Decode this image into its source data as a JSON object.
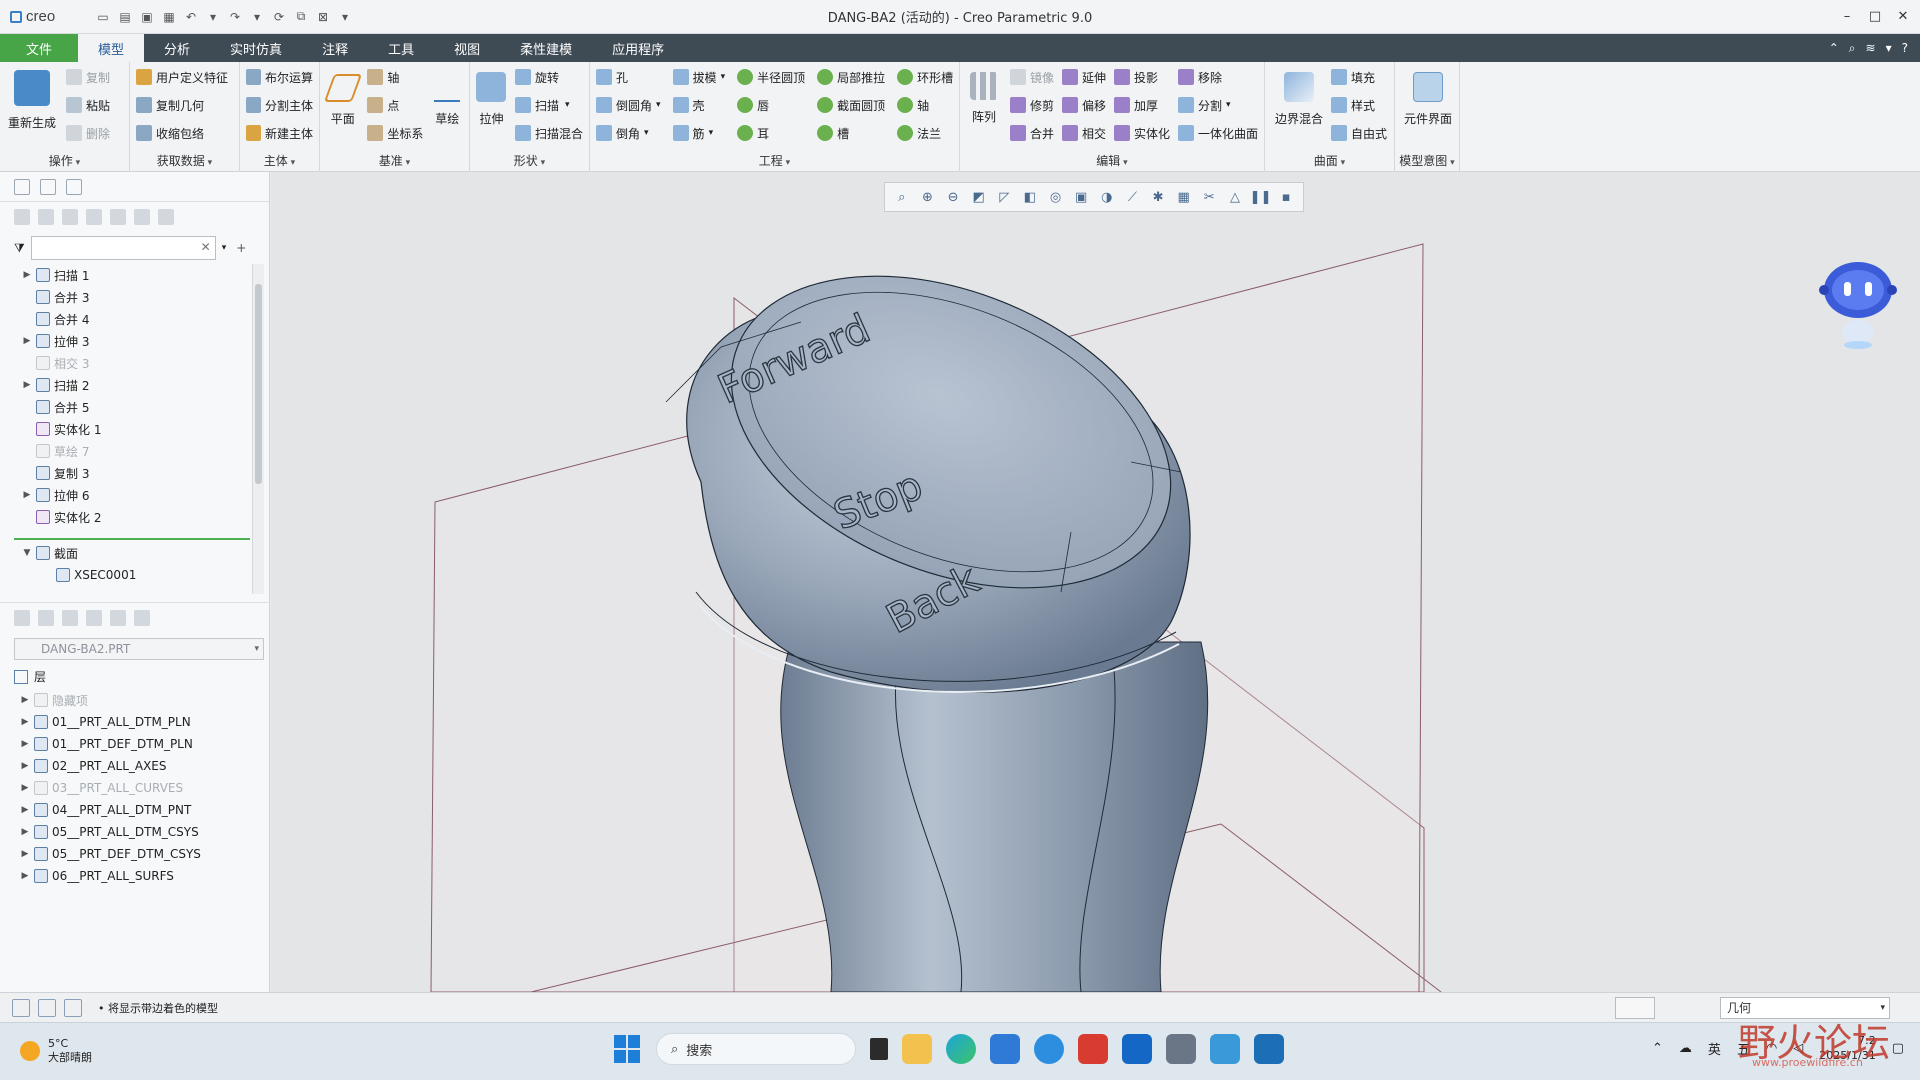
{
  "app": {
    "logo": "creo",
    "window_title": "DANG-BA2 (活动的) - Creo Parametric 9.0"
  },
  "tabs": [
    {
      "label": "文件"
    },
    {
      "label": "模型"
    },
    {
      "label": "分析"
    },
    {
      "label": "实时仿真"
    },
    {
      "label": "注释"
    },
    {
      "label": "工具"
    },
    {
      "label": "视图"
    },
    {
      "label": "柔性建模"
    },
    {
      "label": "应用程序"
    }
  ],
  "ribbon": {
    "operations": {
      "label": "操作",
      "regen": "重新生成",
      "copy": "复制",
      "paste": "粘贴",
      "delete": "删除"
    },
    "get_data": {
      "label": "获取数据",
      "udf": "用户定义特征",
      "copy_geom": "复制几何",
      "shrinkwrap": "收缩包络"
    },
    "body": {
      "label": "主体",
      "boolean": "布尔运算",
      "split_body": "分割主体",
      "new_body": "新建主体"
    },
    "datum": {
      "label": "基准",
      "plane": "平面",
      "axis": "轴",
      "point": "点",
      "csys": "坐标系",
      "sketch": "草绘"
    },
    "shapes": {
      "label": "形状",
      "extrude": "拉伸",
      "revolve": "旋转",
      "sweep": "扫描",
      "swept_blend": "扫描混合"
    },
    "engineering": {
      "label": "工程",
      "hole": "孔",
      "round": "倒圆角",
      "chamfer": "倒角",
      "draft": "拔模",
      "shell": "壳",
      "rib": "筋",
      "radius_dome": "半径圆顶",
      "lip": "唇",
      "ear": "耳",
      "local_push": "局部推拉",
      "section_dome": "截面圆顶",
      "slot": "槽",
      "toroidal_bend": "环形槽",
      "shaft": "轴",
      "flange": "法兰"
    },
    "editing": {
      "label": "编辑",
      "pattern": "阵列",
      "mirror": "镜像",
      "trim": "修剪",
      "merge": "合并",
      "extend": "延伸",
      "offset": "偏移",
      "intersect": "相交",
      "project": "投影",
      "thicken": "加厚",
      "solidify": "实体化",
      "remove": "移除",
      "split": "分割",
      "unify": "一体化曲面"
    },
    "surfaces": {
      "label": "曲面",
      "boundary_blend": "边界混合",
      "fill": "填充",
      "style": "样式",
      "freestyle": "自由式"
    },
    "model_intent": {
      "label": "模型意图",
      "component_interface": "元件界面"
    }
  },
  "model_tree": {
    "items": [
      {
        "label": "扫描 1",
        "expandable": true,
        "suppressed": false
      },
      {
        "label": "合并 3",
        "expandable": false,
        "suppressed": false
      },
      {
        "label": "合并 4",
        "expandable": false,
        "suppressed": false
      },
      {
        "label": "拉伸 3",
        "expandable": true,
        "suppressed": false
      },
      {
        "label": "相交 3",
        "expandable": false,
        "suppressed": true
      },
      {
        "label": "扫描 2",
        "expandable": true,
        "suppressed": false
      },
      {
        "label": "合并 5",
        "expandable": false,
        "suppressed": false
      },
      {
        "label": "实体化 1",
        "expandable": false,
        "suppressed": false
      },
      {
        "label": "草绘 7",
        "expandable": false,
        "suppressed": true
      },
      {
        "label": "复制 3",
        "expandable": false,
        "suppressed": false
      },
      {
        "label": "拉伸 6",
        "expandable": true,
        "suppressed": false
      },
      {
        "label": "实体化 2",
        "expandable": false,
        "suppressed": false
      }
    ],
    "sections_label": "截面",
    "xsec": "XSEC0001"
  },
  "layer_tree": {
    "part": "DANG-BA2.PRT",
    "root": "层",
    "items": [
      {
        "label": "隐藏项",
        "dim": true
      },
      {
        "label": "01__PRT_ALL_DTM_PLN",
        "dim": false
      },
      {
        "label": "01__PRT_DEF_DTM_PLN",
        "dim": false
      },
      {
        "label": "02__PRT_ALL_AXES",
        "dim": false
      },
      {
        "label": "03__PRT_ALL_CURVES",
        "dim": true
      },
      {
        "label": "04__PRT_ALL_DTM_PNT",
        "dim": false
      },
      {
        "label": "05__PRT_ALL_DTM_CSYS",
        "dim": false
      },
      {
        "label": "05__PRT_DEF_DTM_CSYS",
        "dim": false
      },
      {
        "label": "06__PRT_ALL_SURFS",
        "dim": false
      }
    ]
  },
  "model_text": {
    "top": "Forward",
    "middle": "Stop",
    "bottom": "Back"
  },
  "status": {
    "message": "• 将显示带边着色的模型",
    "selection_filter": "几何"
  },
  "taskbar": {
    "temperature": "5°C",
    "weather": "大部晴朗",
    "search": "搜索",
    "ime": "英",
    "ime2": "五",
    "time": "7:2",
    "date": "2025/1/31"
  },
  "watermark": {
    "text": "野火论坛",
    "site": "www.proewildfire.cn"
  },
  "colors": {
    "file_tab": "#47a447",
    "tab_bar": "#3e4a54",
    "model_surface": "#9aa8ba",
    "viewport_bg": "#e3e5e7"
  }
}
